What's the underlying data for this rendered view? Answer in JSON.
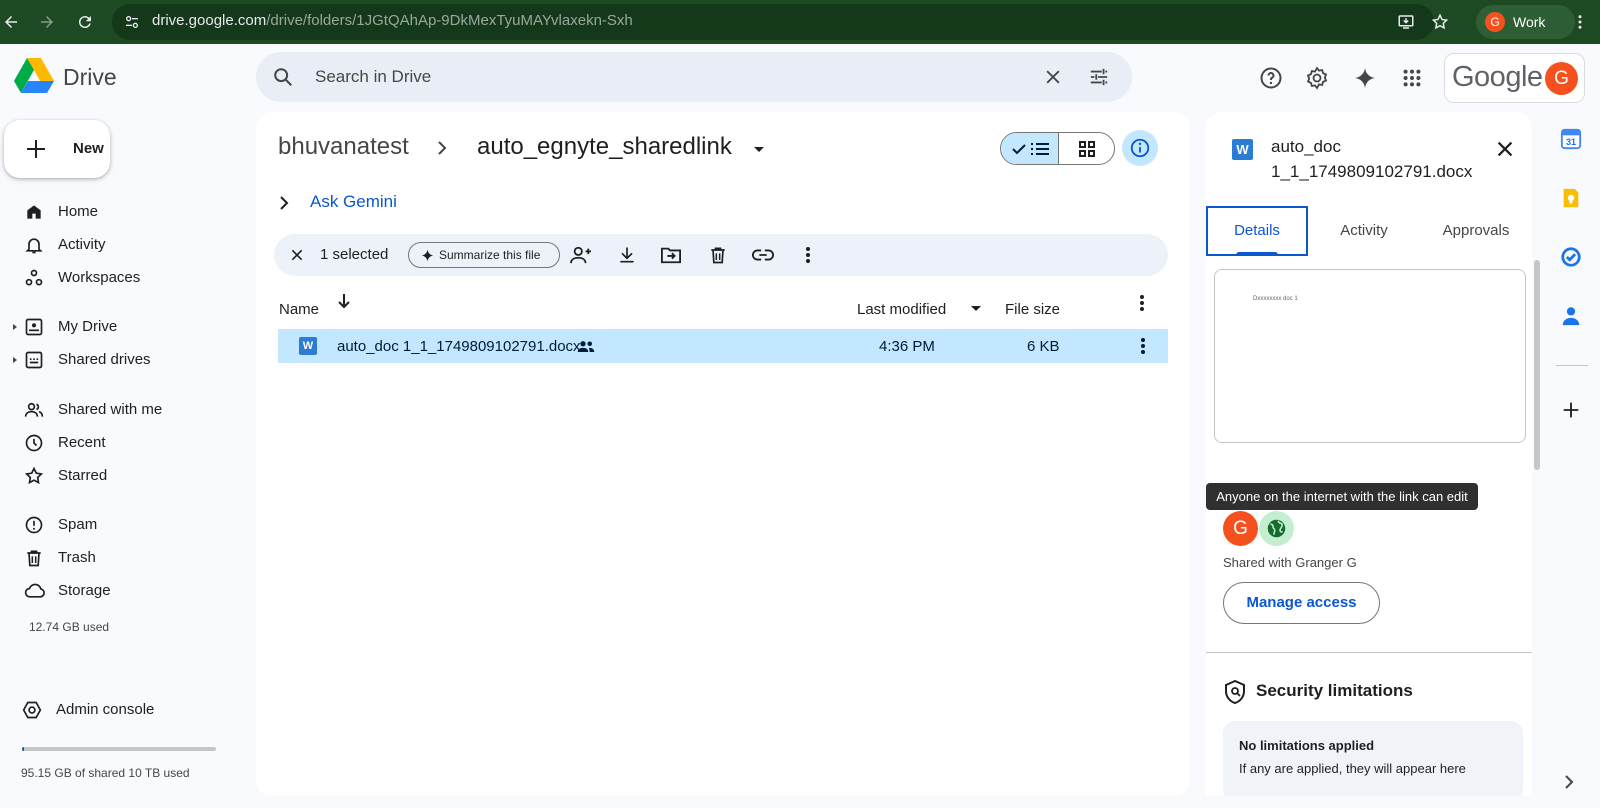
{
  "browser": {
    "url_host": "drive.google.com",
    "url_path": "/drive/folders/1JGtQAhAp-9DkMexTyuMAYvlaxekn-Sxh",
    "profile_initial": "G",
    "profile_label": "Work"
  },
  "header": {
    "app_name": "Drive",
    "search_placeholder": "Search in Drive",
    "google_word": "Google",
    "avatar_initial": "G"
  },
  "sidebar": {
    "new_label": "New",
    "nav_group1": [
      {
        "label": "Home",
        "icon": "home-icon"
      },
      {
        "label": "Activity",
        "icon": "bell-icon"
      },
      {
        "label": "Workspaces",
        "icon": "workspaces-icon"
      }
    ],
    "nav_group2": [
      {
        "label": "My Drive",
        "icon": "my-drive-icon"
      },
      {
        "label": "Shared drives",
        "icon": "shared-drives-icon"
      }
    ],
    "nav_group3": [
      {
        "label": "Shared with me",
        "icon": "people-icon"
      },
      {
        "label": "Recent",
        "icon": "clock-icon"
      },
      {
        "label": "Starred",
        "icon": "star-icon"
      }
    ],
    "nav_group4": [
      {
        "label": "Spam",
        "icon": "spam-icon"
      },
      {
        "label": "Trash",
        "icon": "trash-icon"
      },
      {
        "label": "Storage",
        "icon": "cloud-icon"
      }
    ],
    "storage_used": "12.74 GB used",
    "admin_label": "Admin console",
    "shared_storage": "95.15 GB of shared 10 TB used",
    "shared_storage_fraction": 0.0095
  },
  "main": {
    "breadcrumb_root": "bhuvanatest",
    "breadcrumb_current": "auto_egnyte_sharedlink",
    "ask_gemini": "Ask Gemini",
    "selection_count": "1 selected",
    "summarize_label": "Summarize this file",
    "columns": {
      "name": "Name",
      "last_modified": "Last modified",
      "file_size": "File size"
    },
    "files": [
      {
        "name": "auto_doc 1_1_1749809102791.docx",
        "modified": "4:36 PM",
        "size": "6 KB",
        "type_letter": "W"
      }
    ]
  },
  "details": {
    "type_letter": "W",
    "title_line1": "auto_doc",
    "title_line2": "1_1_1749809102791.docx",
    "tabs": [
      "Details",
      "Activity",
      "Approvals"
    ],
    "preview_text": "Dxxxxxxxx  doc 1",
    "tooltip": "Anyone on the internet with the link can edit",
    "share_avatar_initial": "G",
    "shared_with": "Shared with Granger G",
    "manage_access": "Manage access",
    "security_title": "Security limitations",
    "security_box_title": "No limitations applied",
    "security_box_text": "If any are applied, they will appear here"
  },
  "right_rail": {
    "calendar_day": "31"
  },
  "colors": {
    "browser_bg": "#1d4a22",
    "accent": "#0b57d0",
    "selection": "#c2e7ff",
    "avatar": "#f4511e"
  }
}
